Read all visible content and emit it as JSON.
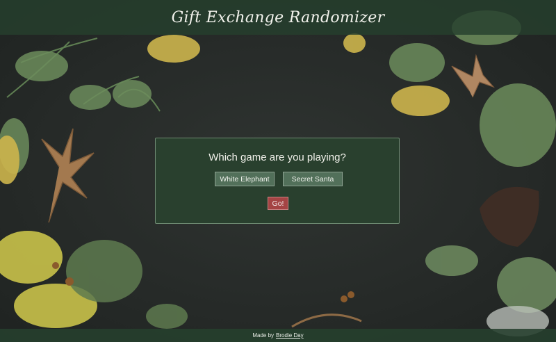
{
  "header": {
    "title": "Gift Exchange Randomizer"
  },
  "game_panel": {
    "question": "Which game are you playing?",
    "options": [
      {
        "label": "White Elephant"
      },
      {
        "label": "Secret Santa"
      }
    ],
    "go_label": "Go!"
  },
  "footer": {
    "prefix": "Made by",
    "author_link": "Brodie Day"
  },
  "colors": {
    "background": "#262a28",
    "header_bar": "#26402d",
    "panel": "#29422e",
    "option_button": "#52705a",
    "go_button": "#a44444"
  }
}
